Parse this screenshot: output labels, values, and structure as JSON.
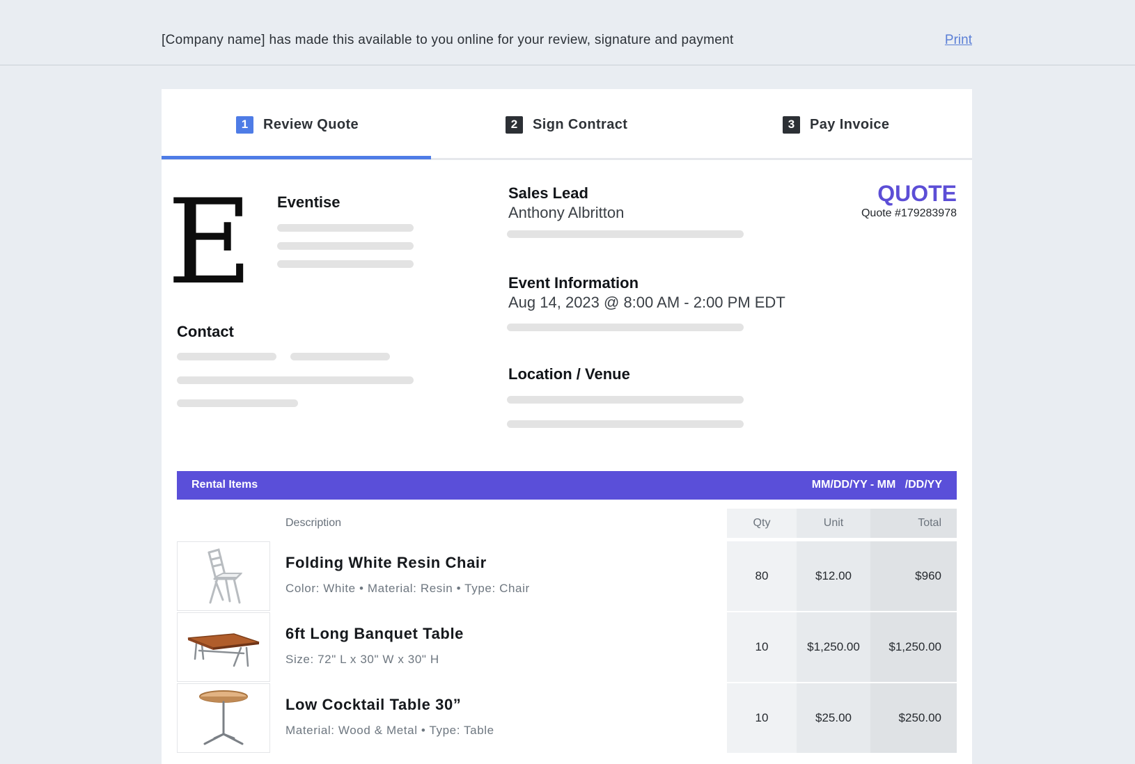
{
  "topbar": {
    "message": "[Company name] has made this available to you online for your review, signature and payment",
    "print_label": "Print"
  },
  "tabs": [
    {
      "number": "1",
      "label": "Review Quote",
      "active": true,
      "color": "#4e7ce6"
    },
    {
      "number": "2",
      "label": "Sign Contract",
      "active": false,
      "color": "#2c3035"
    },
    {
      "number": "3",
      "label": "Pay Invoice",
      "active": false,
      "color": "#2c3035"
    }
  ],
  "company": {
    "logo_letter": "E",
    "name": "Eventise"
  },
  "contact": {
    "title": "Contact"
  },
  "sales_lead": {
    "title": "Sales Lead",
    "name": "Anthony Albritton"
  },
  "event": {
    "title": "Event Information",
    "datetime": "Aug 14, 2023 @ 8:00 AM - 2:00 PM EDT"
  },
  "location": {
    "title": "Location / Venue"
  },
  "quote": {
    "title": "QUOTE",
    "number": "Quote #179283978",
    "accent_color": "#5c4ed6"
  },
  "rental": {
    "band_label": "Rental Items",
    "date_range": "MM/DD/YY - MM   /DD/YY",
    "band_color": "#5a4fd9",
    "columns": {
      "description": "Description",
      "qty": "Qty",
      "unit": "Unit",
      "total": "Total"
    },
    "items": [
      {
        "name": "Folding White Resin Chair",
        "specs": "Color: White •  Material: Resin • Type: Chair",
        "qty": "80",
        "unit": "$12.00",
        "total": "$960",
        "icon": "chair-image"
      },
      {
        "name": "6ft Long Banquet Table",
        "specs": "Size: 72\" L x 30\" W x 30\" H",
        "qty": "10",
        "unit": "$1,250.00",
        "total": "$1,250.00",
        "icon": "banquet-table-image"
      },
      {
        "name": "Low Cocktail Table 30”",
        "specs": "Material: Wood & Metal • Type: Table",
        "qty": "10",
        "unit": "$25.00",
        "total": "$250.00",
        "icon": "cocktail-table-image"
      }
    ]
  }
}
